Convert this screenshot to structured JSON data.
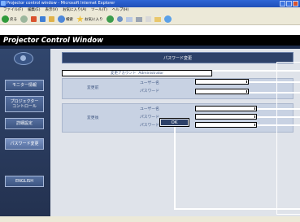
{
  "window": {
    "title": "Projector control window - Microsoft Internet Explorer"
  },
  "menubar": {
    "items": [
      "ファイル(F)",
      "編集(E)",
      "表示(V)",
      "お気に入り(A)",
      "ツール(T)",
      "ヘルプ(H)"
    ]
  },
  "toolbar": {
    "back_label": "戻る",
    "search_label": "検索",
    "favorites_label": "お気に入り"
  },
  "app": {
    "title": "Projector Control Window"
  },
  "sidebar": {
    "items": [
      {
        "label": "モニター情報"
      },
      {
        "label": "プロジェクター\nコントロール"
      },
      {
        "label": "詳細設定"
      },
      {
        "label": "パスワード変更"
      },
      {
        "label": "ENGLISH"
      }
    ]
  },
  "password_page": {
    "header": "パスワード変更",
    "account_label": "変更アカウント",
    "account_value": "Administrator",
    "before": {
      "section_label": "変更前",
      "username_label": "ユーザー名",
      "password_label": "パスワード"
    },
    "after": {
      "section_label": "変更後",
      "username_label": "ユーザー名",
      "password_label": "パスワード",
      "password_confirm_label": "パスワード(再入力)"
    },
    "ok_label": "OK"
  },
  "colors": {
    "page_bg": "#000000",
    "panel_bg": "#dfe3ea",
    "header_bg": "#2d4169",
    "sidebar_bg": "#31466d"
  }
}
